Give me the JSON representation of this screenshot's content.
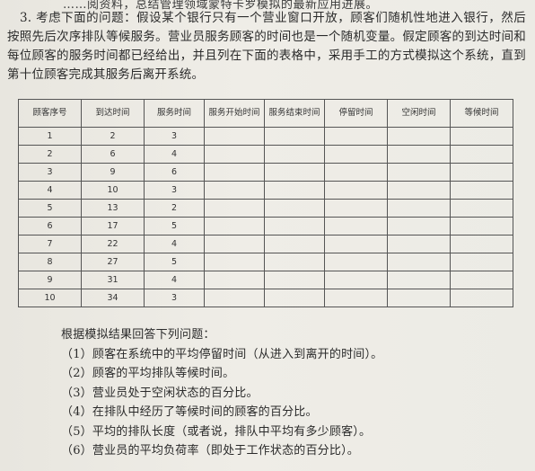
{
  "top_cut_text": "……阅资料，总结管理领域蒙特卡罗模拟的最新应用进展。",
  "problem": {
    "number": "3.",
    "text": "考虑下面的问题：假设某个银行只有一个营业窗口开放，顾客们随机性地进入银行，然后按照先后次序排队等候服务。营业员服务顾客的时间也是一个随机变量。假定顾客的到达时间和每位顾客的服务时间都已经给出，并且列在下面的表格中，采用手工的方式模拟这个系统，直到第十位顾客完成其服务后离开系统。"
  },
  "table": {
    "headers": [
      "顾客序号",
      "到达时间",
      "服务时间",
      "服务开始时间",
      "服务结束时间",
      "停留时间",
      "空闲时间",
      "等候时间"
    ],
    "rows": [
      [
        "1",
        "2",
        "3"
      ],
      [
        "2",
        "6",
        "4"
      ],
      [
        "3",
        "9",
        "6"
      ],
      [
        "4",
        "10",
        "3"
      ],
      [
        "5",
        "13",
        "2"
      ],
      [
        "6",
        "17",
        "5"
      ],
      [
        "7",
        "22",
        "4"
      ],
      [
        "8",
        "27",
        "5"
      ],
      [
        "9",
        "31",
        "4"
      ],
      [
        "10",
        "34",
        "3"
      ]
    ]
  },
  "questions": {
    "intro": "根据模拟结果回答下列问题：",
    "items": [
      "（1）顾客在系统中的平均停留时间（从进入到离开的时间）。",
      "（2）顾客的平均排队等候时间。",
      "（3）营业员处于空闲状态的百分比。",
      "（4）在排队中经历了等候时间的顾客的百分比。",
      "（5）平均的排队长度（或者说，排队中平均有多少顾客）。",
      "（6）营业员的平均负荷率（即处于工作状态的百分比）。"
    ]
  }
}
